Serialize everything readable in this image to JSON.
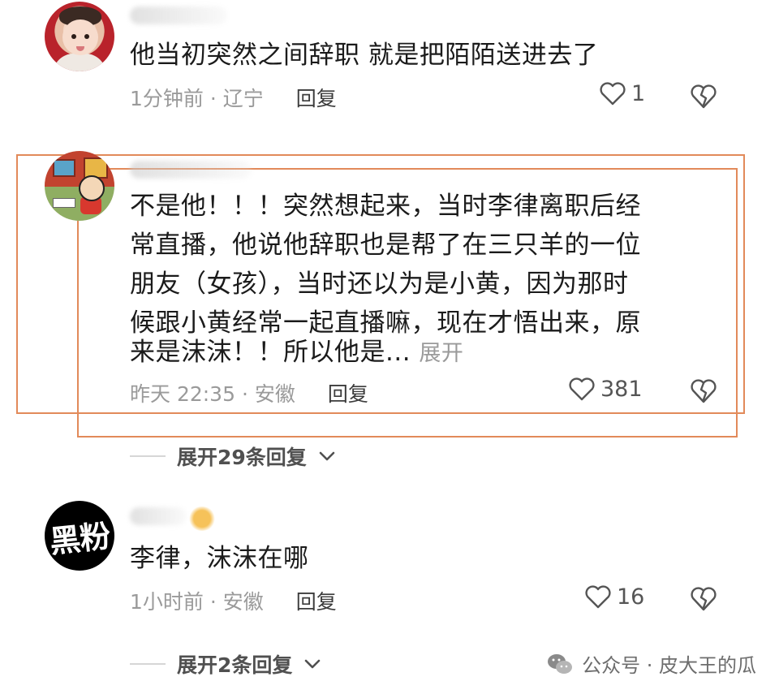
{
  "comments": [
    {
      "text_lines": [
        "他当初突然之间辞职  就是把陌陌送进去了"
      ],
      "time": "1分钟前 · 辽宁",
      "reply_label": "回复",
      "likes": "1"
    },
    {
      "text_lines": [
        "不是他！！！突然想起来，当时李律离职后经",
        "常直播，他说他辞职也是帮了在三只羊的一位",
        "朋友（女孩），当时还以为是小黄，因为那时",
        "候跟小黄经常一起直播嘛，现在才悟出来，原",
        "来是沫沫！！所以他是..."
      ],
      "expand_label": "展开",
      "time": "昨天 22:35 · 安徽",
      "reply_label": "回复",
      "likes": "381",
      "expand_replies": "展开29条回复"
    },
    {
      "avatar_text": "黑粉",
      "text_lines": [
        "李律，沫沫在哪"
      ],
      "time": "1小时前 · 安徽",
      "reply_label": "回复",
      "likes": "16",
      "expand_replies": "展开2条回复"
    }
  ],
  "watermark": "公众号 · 皮大王的瓜",
  "colors": {
    "highlight_box": "#e28a5a",
    "meta_gray": "#9a9a9a"
  }
}
